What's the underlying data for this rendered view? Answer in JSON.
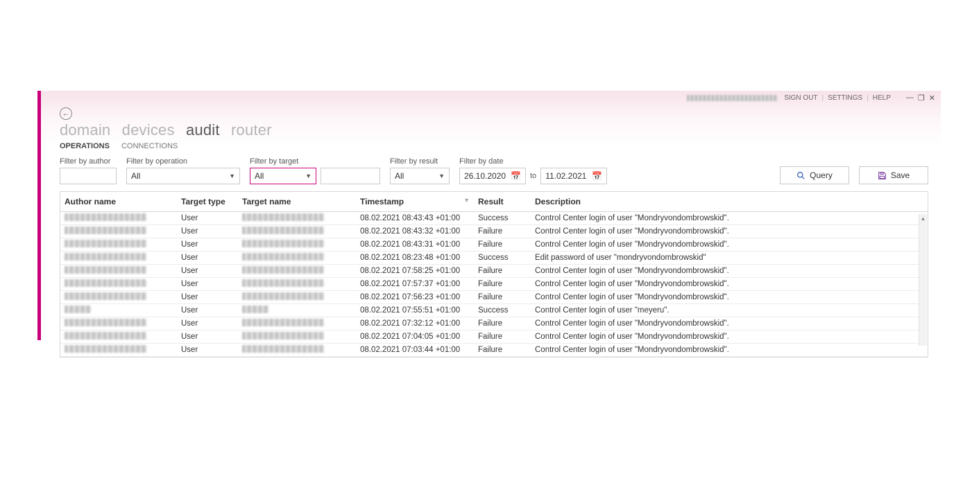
{
  "top": {
    "sign_out": "SIGN OUT",
    "settings": "SETTINGS",
    "help": "HELP"
  },
  "nav": {
    "items": [
      "domain",
      "devices",
      "audit",
      "router"
    ],
    "active_index": 2
  },
  "subtabs": {
    "items": [
      "OPERATIONS",
      "CONNECTIONS"
    ],
    "active_index": 0
  },
  "filters": {
    "author": {
      "label": "Filter by author",
      "value": ""
    },
    "operation": {
      "label": "Filter by operation",
      "value": "All"
    },
    "target": {
      "label": "Filter by target",
      "select_value": "All",
      "text_value": ""
    },
    "result": {
      "label": "Filter by result",
      "value": "All"
    },
    "date": {
      "label": "Filter by date",
      "from": "26.10.2020",
      "to_label": "to",
      "to": "11.02.2021"
    }
  },
  "buttons": {
    "query": "Query",
    "save": "Save"
  },
  "columns": {
    "author": "Author name",
    "type": "Target type",
    "target": "Target name",
    "timestamp": "Timestamp",
    "result": "Result",
    "description": "Description"
  },
  "rows": [
    {
      "author_blur": "long",
      "type": "User",
      "target_blur": "med",
      "ts": "08.02.2021 08:43:43 +01:00",
      "result": "Success",
      "desc": "Control Center login of user \"Mondryvondombrowskid\"."
    },
    {
      "author_blur": "long",
      "type": "User",
      "target_blur": "med",
      "ts": "08.02.2021 08:43:32 +01:00",
      "result": "Failure",
      "desc": "Control Center login of user \"Mondryvondombrowskid\"."
    },
    {
      "author_blur": "long",
      "type": "User",
      "target_blur": "med",
      "ts": "08.02.2021 08:43:31 +01:00",
      "result": "Failure",
      "desc": "Control Center login of user \"Mondryvondombrowskid\"."
    },
    {
      "author_blur": "long",
      "type": "User",
      "target_blur": "med",
      "ts": "08.02.2021 08:23:48 +01:00",
      "result": "Success",
      "desc": "Edit password of user \"mondryvondombrowskid\""
    },
    {
      "author_blur": "long",
      "type": "User",
      "target_blur": "med",
      "ts": "08.02.2021 07:58:25 +01:00",
      "result": "Failure",
      "desc": "Control Center login of user \"Mondryvondombrowskid\"."
    },
    {
      "author_blur": "long",
      "type": "User",
      "target_blur": "med",
      "ts": "08.02.2021 07:57:37 +01:00",
      "result": "Failure",
      "desc": "Control Center login of user \"Mondryvondombrowskid\"."
    },
    {
      "author_blur": "long",
      "type": "User",
      "target_blur": "med",
      "ts": "08.02.2021 07:56:23 +01:00",
      "result": "Failure",
      "desc": "Control Center login of user \"Mondryvondombrowskid\"."
    },
    {
      "author_blur": "short",
      "type": "User",
      "target_blur": "short",
      "ts": "08.02.2021 07:55:51 +01:00",
      "result": "Success",
      "desc": "Control Center login of user \"meyeru\"."
    },
    {
      "author_blur": "long",
      "type": "User",
      "target_blur": "med",
      "ts": "08.02.2021 07:32:12 +01:00",
      "result": "Failure",
      "desc": "Control Center login of user \"Mondryvondombrowskid\"."
    },
    {
      "author_blur": "long",
      "type": "User",
      "target_blur": "med",
      "ts": "08.02.2021 07:04:05 +01:00",
      "result": "Failure",
      "desc": "Control Center login of user \"Mondryvondombrowskid\"."
    },
    {
      "author_blur": "long",
      "type": "User",
      "target_blur": "med",
      "ts": "08.02.2021 07:03:44 +01:00",
      "result": "Failure",
      "desc": "Control Center login of user \"Mondryvondombrowskid\"."
    }
  ]
}
